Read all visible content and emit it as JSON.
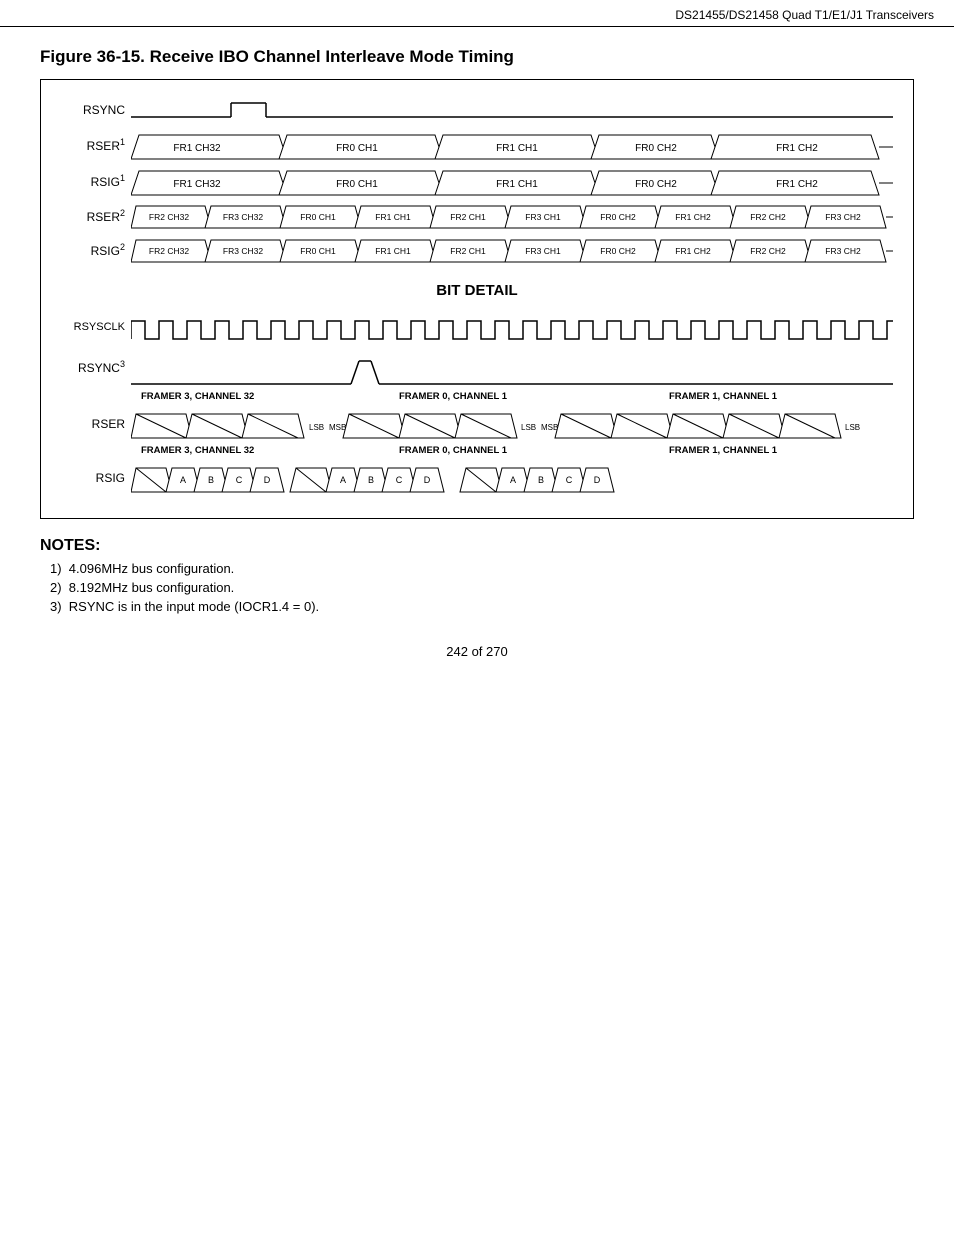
{
  "header": {
    "title": "DS21455/DS21458 Quad T1/E1/J1 Transceivers"
  },
  "figure": {
    "title": "Figure 36-15. Receive IBO Channel Interleave Mode Timing"
  },
  "signals": {
    "rsync": "RSYNC",
    "rser1": "RSER",
    "rsig1": "RSIG",
    "rser2": "RSER",
    "rsig2": "RSIG",
    "rsysclk": "RSYSCLK",
    "rsync3": "RSYNC",
    "rser_bd": "RSER",
    "rsig_bd": "RSIG"
  },
  "rser1_segs": [
    "FR1 CH32",
    "FR0 CH1",
    "FR1 CH1",
    "FR0 CH2",
    "FR1 CH2"
  ],
  "rsig1_segs": [
    "FR1 CH32",
    "FR0 CH1",
    "FR1 CH1",
    "FR0 CH2",
    "FR1 CH2"
  ],
  "rser2_segs": [
    "FR2 CH32",
    "FR3 CH32",
    "FR0 CH1",
    "FR1 CH1",
    "FR2 CH1",
    "FR3 CH1",
    "FR0 CH2",
    "FR1 CH2",
    "FR2 CH2",
    "FR3 CH2"
  ],
  "rsig2_segs": [
    "FR2 CH32",
    "FR3 CH32",
    "FR0 CH1",
    "FR1 CH1",
    "FR2 CH1",
    "FR3 CH1",
    "FR0 CH2",
    "FR1 CH2",
    "FR2 CH2",
    "FR3 CH2"
  ],
  "bit_detail": {
    "title": "BIT DETAIL",
    "framer3_label": "FRAMER 3, CHANNEL 32",
    "framer0_label": "FRAMER 0, CHANNEL 1",
    "framer1_label": "FRAMER 1, CHANNEL 1",
    "rser_lsb": "LSB",
    "rser_msb": "MSB",
    "rsig_a": "A",
    "rsig_b": "B",
    "rsig_c": "C",
    "rsig_d": "D"
  },
  "notes": {
    "title": "NOTES:",
    "items": [
      "4.096MHz bus configuration.",
      "8.192MHz bus configuration.",
      "RSYNC is in the input mode (IOCR1.4 = 0)."
    ]
  },
  "footer": {
    "page": "242 of 270"
  }
}
